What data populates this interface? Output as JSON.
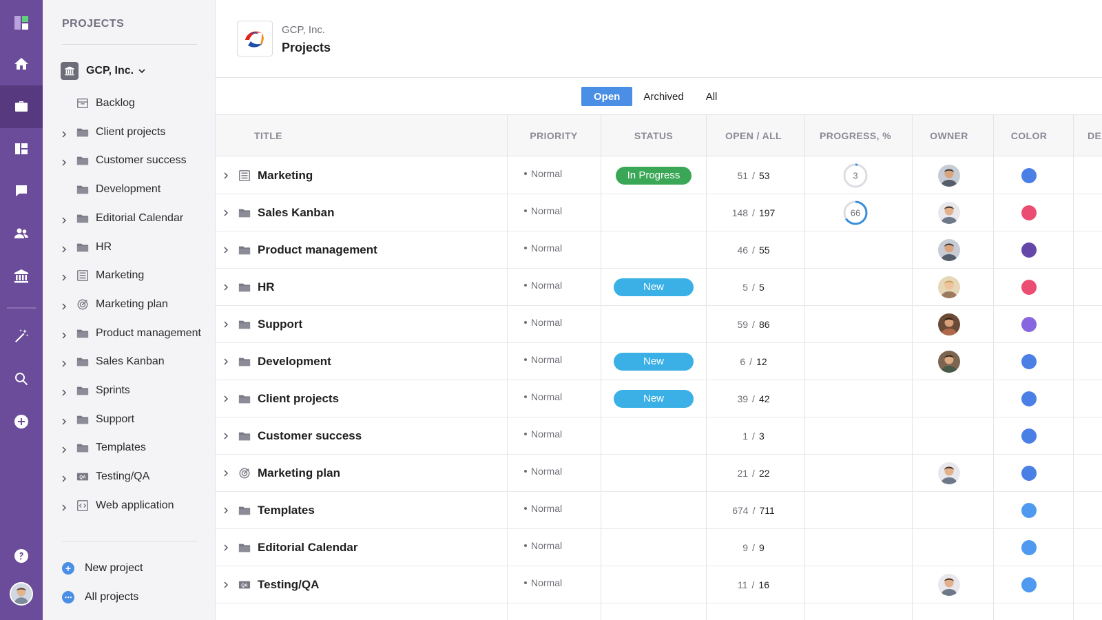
{
  "rail": {
    "items": [
      {
        "icon": "logo-icon"
      },
      {
        "icon": "home-icon"
      },
      {
        "icon": "briefcase-icon",
        "active": true
      },
      {
        "icon": "board-icon"
      },
      {
        "icon": "chat-icon"
      },
      {
        "icon": "people-icon"
      },
      {
        "icon": "bank-icon"
      },
      {
        "icon": "magic-wand-icon"
      },
      {
        "icon": "search-icon"
      },
      {
        "icon": "add-icon"
      },
      {
        "icon": "help-icon"
      }
    ]
  },
  "sidebar": {
    "title": "PROJECTS",
    "org_name": "GCP, Inc.",
    "items": [
      {
        "label": "Backlog",
        "icon": "backlog-icon",
        "expandable": false
      },
      {
        "label": "Client projects",
        "icon": "folder-icon",
        "expandable": true
      },
      {
        "label": "Customer success",
        "icon": "folder-icon",
        "expandable": true
      },
      {
        "label": "Development",
        "icon": "folder-icon",
        "expandable": false
      },
      {
        "label": "Editorial Calendar",
        "icon": "folder-icon",
        "expandable": true
      },
      {
        "label": "HR",
        "icon": "folder-icon",
        "expandable": true
      },
      {
        "label": "Marketing",
        "icon": "list-icon",
        "expandable": true
      },
      {
        "label": "Marketing plan",
        "icon": "target-icon",
        "expandable": true
      },
      {
        "label": "Product management",
        "icon": "folder-icon",
        "expandable": true
      },
      {
        "label": "Sales Kanban",
        "icon": "folder-icon",
        "expandable": true
      },
      {
        "label": "Sprints",
        "icon": "folder-icon",
        "expandable": true
      },
      {
        "label": "Support",
        "icon": "folder-icon",
        "expandable": true
      },
      {
        "label": "Templates",
        "icon": "folder-icon",
        "expandable": true
      },
      {
        "label": "Testing/QA",
        "icon": "qa-icon",
        "expandable": true
      },
      {
        "label": "Web application",
        "icon": "code-icon",
        "expandable": true
      }
    ],
    "new_project": "New project",
    "all_projects": "All projects"
  },
  "header": {
    "company": "GCP, Inc.",
    "title": "Projects"
  },
  "tabs": [
    {
      "label": "Open",
      "active": true
    },
    {
      "label": "Archived",
      "active": false
    },
    {
      "label": "All",
      "active": false
    }
  ],
  "columns": {
    "title": "TITLE",
    "priority": "PRIORITY",
    "status": "STATUS",
    "open_all": "OPEN / ALL",
    "progress": "PROGRESS, %",
    "owner": "OWNER",
    "color": "COLOR",
    "deadline": "DEA"
  },
  "colors": {
    "accent": "#4a8ee6",
    "in_progress": "#3aa757",
    "new": "#3ab0e6"
  },
  "rows": [
    {
      "title": "Marketing",
      "icon": "list-icon",
      "priority": "Normal",
      "status": "In Progress",
      "open": "51",
      "all": "53",
      "progress": 3,
      "owner": "man-beard",
      "color": "#4a7fe6"
    },
    {
      "title": "Sales Kanban",
      "icon": "folder-icon",
      "priority": "Normal",
      "status": "",
      "open": "148",
      "all": "197",
      "progress": 66,
      "owner": "man-short",
      "color": "#eb4d72"
    },
    {
      "title": "Product management",
      "icon": "folder-icon",
      "priority": "Normal",
      "status": "",
      "open": "46",
      "all": "55",
      "progress": null,
      "owner": "man-beard",
      "color": "#6547a8"
    },
    {
      "title": "HR",
      "icon": "folder-icon",
      "priority": "Normal",
      "status": "New",
      "open": "5",
      "all": "5",
      "progress": null,
      "owner": "woman-blonde",
      "color": "#eb4d72"
    },
    {
      "title": "Support",
      "icon": "folder-icon",
      "priority": "Normal",
      "status": "",
      "open": "59",
      "all": "86",
      "progress": null,
      "owner": "woman-dark",
      "color": "#8766e0"
    },
    {
      "title": "Development",
      "icon": "folder-icon",
      "priority": "Normal",
      "status": "New",
      "open": "6",
      "all": "12",
      "progress": null,
      "owner": "man-smile",
      "color": "#4a7fe6"
    },
    {
      "title": "Client projects",
      "icon": "folder-icon",
      "priority": "Normal",
      "status": "New",
      "open": "39",
      "all": "42",
      "progress": null,
      "owner": "",
      "color": "#4a7fe6"
    },
    {
      "title": "Customer success",
      "icon": "folder-icon",
      "priority": "Normal",
      "status": "",
      "open": "1",
      "all": "3",
      "progress": null,
      "owner": "",
      "color": "#4a7fe6"
    },
    {
      "title": "Marketing plan",
      "icon": "target-icon",
      "priority": "Normal",
      "status": "",
      "open": "21",
      "all": "22",
      "progress": null,
      "owner": "man-short",
      "color": "#4a7fe6"
    },
    {
      "title": "Templates",
      "icon": "folder-icon",
      "priority": "Normal",
      "status": "",
      "open": "674",
      "all": "711",
      "progress": null,
      "owner": "",
      "color": "#4f9af0"
    },
    {
      "title": "Editorial Calendar",
      "icon": "folder-icon",
      "priority": "Normal",
      "status": "",
      "open": "9",
      "all": "9",
      "progress": null,
      "owner": "",
      "color": "#4f9af0"
    },
    {
      "title": "Testing/QA",
      "icon": "qa-icon",
      "priority": "Normal",
      "status": "",
      "open": "11",
      "all": "16",
      "progress": null,
      "owner": "man-short",
      "color": "#4f9af0"
    }
  ]
}
